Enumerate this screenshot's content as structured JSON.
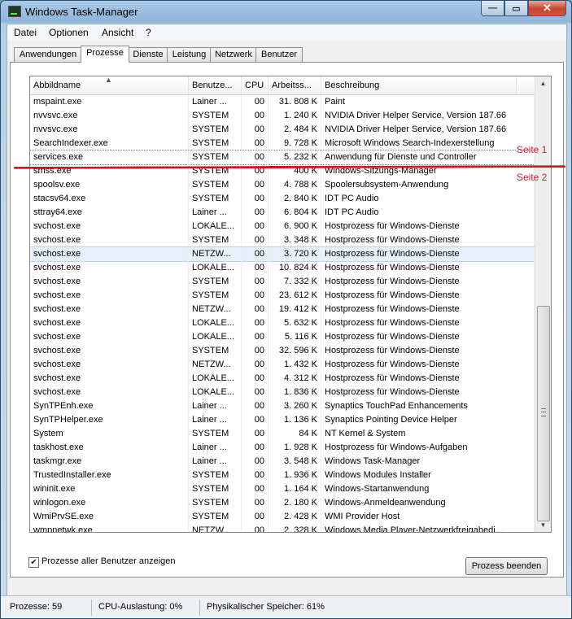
{
  "window": {
    "title": "Windows Task-Manager"
  },
  "menu": [
    "Datei",
    "Optionen",
    "Ansicht",
    "?"
  ],
  "tabs": [
    "Anwendungen",
    "Prozesse",
    "Dienste",
    "Leistung",
    "Netzwerk",
    "Benutzer"
  ],
  "active_tab": "Prozesse",
  "columns": [
    "Abbildname",
    "Benutze...",
    "CPU",
    "Arbeitss...",
    "Beschreibung"
  ],
  "processes": [
    [
      "mspaint.exe",
      "Lainer ...",
      "00",
      "31. 808 K",
      "Paint"
    ],
    [
      "nvvsvc.exe",
      "SYSTEM",
      "00",
      "1. 240 K",
      "NVIDIA Driver Helper Service, Version 187.66"
    ],
    [
      "nvvsvc.exe",
      "SYSTEM",
      "00",
      "2. 484 K",
      "NVIDIA Driver Helper Service, Version 187.66"
    ],
    [
      "SearchIndexer.exe",
      "SYSTEM",
      "00",
      "9. 728 K",
      "Microsoft Windows Search-Indexerstellung"
    ],
    [
      "services.exe",
      "SYSTEM",
      "00",
      "5. 232 K",
      "Anwendung für Dienste und Controller"
    ],
    [
      "smss.exe",
      "SYSTEM",
      "00",
      "400 K",
      "Windows-Sitzungs-Manager"
    ],
    [
      "spoolsv.exe",
      "SYSTEM",
      "00",
      "4. 788 K",
      "Spoolersubsystem-Anwendung"
    ],
    [
      "stacsv64.exe",
      "SYSTEM",
      "00",
      "2. 840 K",
      "IDT PC Audio"
    ],
    [
      "sttray64.exe",
      "Lainer ...",
      "00",
      "6. 804 K",
      "IDT PC Audio"
    ],
    [
      "svchost.exe",
      "LOKALE...",
      "00",
      "6. 900 K",
      "Hostprozess für Windows-Dienste"
    ],
    [
      "svchost.exe",
      "SYSTEM",
      "00",
      "3. 348 K",
      "Hostprozess für Windows-Dienste"
    ],
    [
      "svchost.exe",
      "NETZW...",
      "00",
      "3. 720 K",
      "Hostprozess für Windows-Dienste"
    ],
    [
      "svchost.exe",
      "LOKALE...",
      "00",
      "10. 824 K",
      "Hostprozess für Windows-Dienste"
    ],
    [
      "svchost.exe",
      "SYSTEM",
      "00",
      "7. 332 K",
      "Hostprozess für Windows-Dienste"
    ],
    [
      "svchost.exe",
      "SYSTEM",
      "00",
      "23. 612 K",
      "Hostprozess für Windows-Dienste"
    ],
    [
      "svchost.exe",
      "NETZW...",
      "00",
      "19. 412 K",
      "Hostprozess für Windows-Dienste"
    ],
    [
      "svchost.exe",
      "LOKALE...",
      "00",
      "5. 632 K",
      "Hostprozess für Windows-Dienste"
    ],
    [
      "svchost.exe",
      "LOKALE...",
      "00",
      "5. 116 K",
      "Hostprozess für Windows-Dienste"
    ],
    [
      "svchost.exe",
      "SYSTEM",
      "00",
      "32. 596 K",
      "Hostprozess für Windows-Dienste"
    ],
    [
      "svchost.exe",
      "NETZW...",
      "00",
      "1. 432 K",
      "Hostprozess für Windows-Dienste"
    ],
    [
      "svchost.exe",
      "LOKALE...",
      "00",
      "4. 312 K",
      "Hostprozess für Windows-Dienste"
    ],
    [
      "svchost.exe",
      "LOKALE...",
      "00",
      "1. 836 K",
      "Hostprozess für Windows-Dienste"
    ],
    [
      "SynTPEnh.exe",
      "Lainer ...",
      "00",
      "3. 260 K",
      "Synaptics TouchPad Enhancements"
    ],
    [
      "SynTPHelper.exe",
      "Lainer ...",
      "00",
      "1. 136 K",
      "Synaptics Pointing Device Helper"
    ],
    [
      "System",
      "SYSTEM",
      "00",
      "84 K",
      "NT Kernel & System"
    ],
    [
      "taskhost.exe",
      "Lainer ...",
      "00",
      "1. 928 K",
      "Hostprozess für Windows-Aufgaben"
    ],
    [
      "taskmgr.exe",
      "Lainer ...",
      "00",
      "3. 548 K",
      "Windows Task-Manager"
    ],
    [
      "TrustedInstaller.exe",
      "SYSTEM",
      "00",
      "1. 936 K",
      "Windows Modules Installer"
    ],
    [
      "wininit.exe",
      "SYSTEM",
      "00",
      "1. 164 K",
      "Windows-Startanwendung"
    ],
    [
      "winlogon.exe",
      "SYSTEM",
      "00",
      "2. 180 K",
      "Windows-Anmeldeanwendung"
    ],
    [
      "WmiPrvSE.exe",
      "SYSTEM",
      "00",
      "2. 428 K",
      "WMI Provider Host"
    ],
    [
      "wmpnetwk.exe",
      "NETZW...",
      "00",
      "2. 328 K",
      "Windows Media Player-Netzwerkfreigabedi..."
    ]
  ],
  "selected_row": 11,
  "focused_row": 4,
  "annotations": {
    "page1": "Seite 1",
    "page2": "Seite 2"
  },
  "show_all_users": {
    "label": "Prozesse aller Benutzer anzeigen",
    "checked": true
  },
  "end_process_button": "Prozess beenden",
  "status": {
    "processes": "Prozesse: 59",
    "cpu": "CPU-Auslastung: 0%",
    "memory": "Physikalischer Speicher: 61%"
  },
  "colors": {
    "annotation_red": "#d2141c",
    "selection": "#e7f1fb",
    "close_button": "#c8452c"
  }
}
